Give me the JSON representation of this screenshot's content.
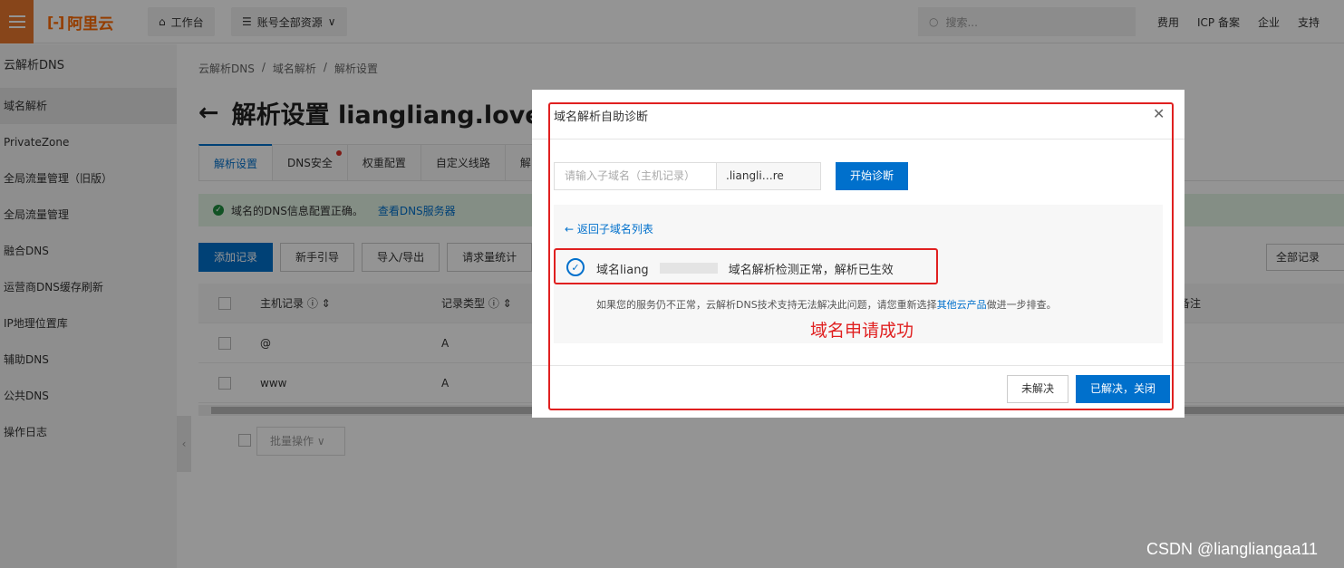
{
  "topbar": {
    "logo": "阿里云",
    "logo_mark": "[-]",
    "workbench": "工作台",
    "resources": "账号全部资源",
    "search_placeholder": "搜索...",
    "links": [
      "费用",
      "ICP 备案",
      "企业",
      "支持"
    ]
  },
  "sidebar": {
    "title": "云解析DNS",
    "items": [
      "域名解析",
      "PrivateZone",
      "全局流量管理（旧版）",
      "全局流量管理",
      "融合DNS",
      "运营商DNS缓存刷新",
      "IP地理位置库",
      "辅助DNS",
      "公共DNS",
      "操作日志"
    ]
  },
  "main": {
    "breadcrumb": [
      "云解析DNS",
      "/",
      "域名解析",
      "/",
      "解析设置"
    ],
    "title": "解析设置 liangliang.love",
    "tabs": [
      "解析设置",
      "DNS安全",
      "权重配置",
      "自定义线路",
      "解"
    ],
    "notice": "域名的DNS信息配置正确。",
    "notice_link": "查看DNS服务器",
    "toolbar": [
      "添加记录",
      "新手引导",
      "导入/导出",
      "请求量统计"
    ],
    "right_select": "全部记录",
    "table": {
      "headers": [
        "主机记录 ⓘ ⇕",
        "记录类型 ⓘ ⇕",
        "备注"
      ],
      "rows": [
        [
          "@",
          "A"
        ],
        [
          "www",
          "A"
        ]
      ]
    },
    "bulk": "批量操作 ∨"
  },
  "dialog": {
    "title": "域名解析自助诊断",
    "input_placeholder": "请输入子域名（主机记录）",
    "suffix": ".liangli…re",
    "diagnose_button": "开始诊断",
    "back_link": "← 返回子域名列表",
    "result_prefix": "域名liang",
    "result_text": "域名解析检测正常，解析已生效",
    "hint_before": "如果您的服务仍不正常，云解析DNS技术支持无法解决此问题，请您重新选择",
    "hint_link": "其他云产品",
    "hint_after": "做进一步排查。",
    "annotation": "域名申请成功",
    "unsolved_button": "未解决",
    "solved_button": "已解决，关闭"
  },
  "watermark": "CSDN @liangliangaa11"
}
